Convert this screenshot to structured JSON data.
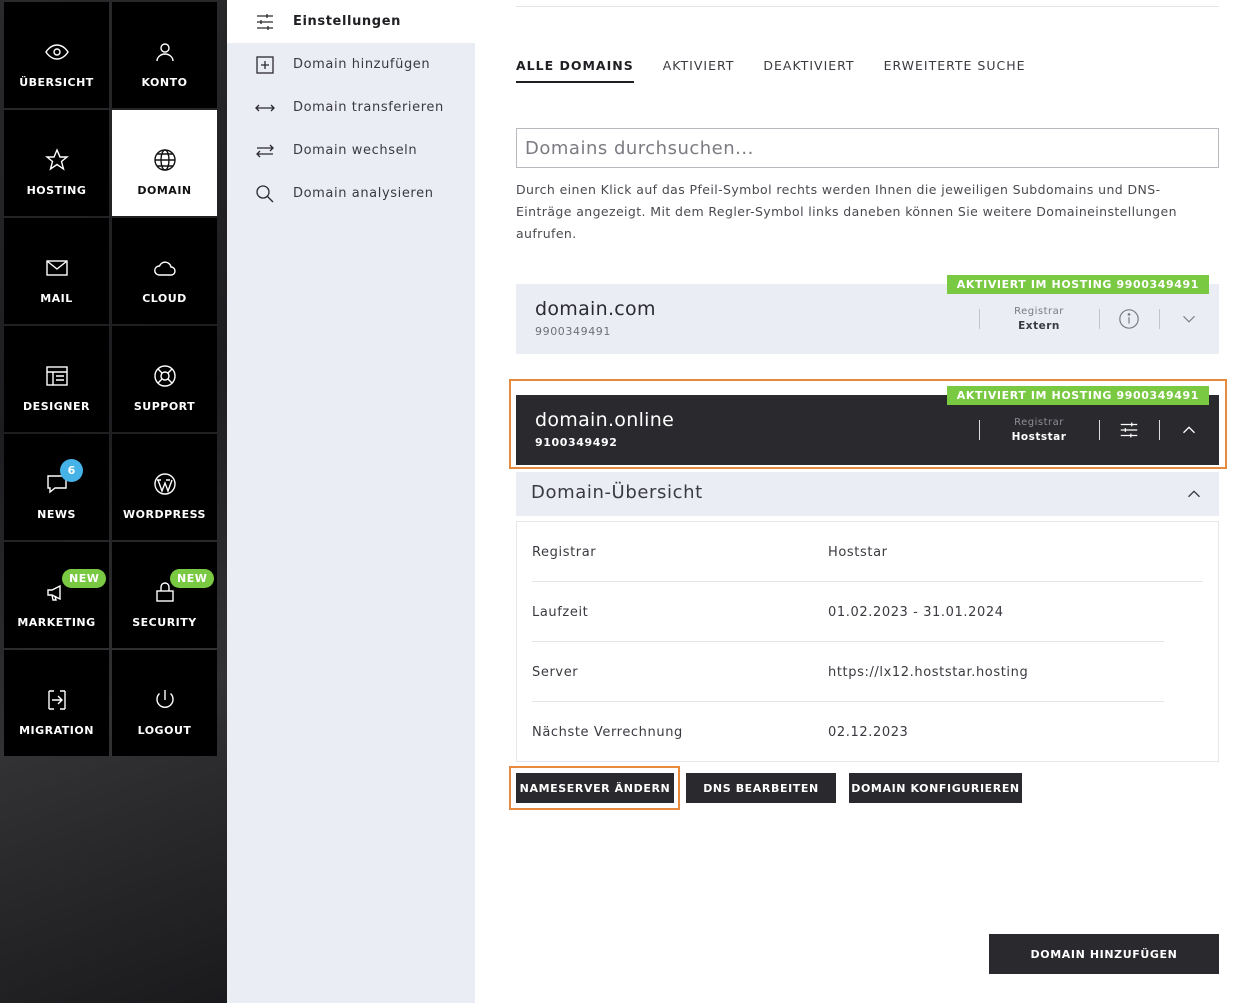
{
  "tiles": [
    {
      "label": "ÜBERSICHT",
      "icon": "eye-icon"
    },
    {
      "label": "KONTO",
      "icon": "user-icon"
    },
    {
      "label": "HOSTING",
      "icon": "star-icon"
    },
    {
      "label": "DOMAIN",
      "icon": "globe-icon"
    },
    {
      "label": "MAIL",
      "icon": "envelope-icon"
    },
    {
      "label": "CLOUD",
      "icon": "cloud-icon"
    },
    {
      "label": "DESIGNER",
      "icon": "layout-icon"
    },
    {
      "label": "SUPPORT",
      "icon": "lifebuoy-icon"
    },
    {
      "label": "NEWS",
      "icon": "chat-bubble-icon",
      "badge": "6"
    },
    {
      "label": "WORDPRESS",
      "icon": "wordpress-icon"
    },
    {
      "label": "MARKETING",
      "icon": "megaphone-icon",
      "badge": "NEW"
    },
    {
      "label": "SECURITY",
      "icon": "lock-icon",
      "badge": "NEW"
    },
    {
      "label": "MIGRATION",
      "icon": "migration-icon"
    },
    {
      "label": "LOGOUT",
      "icon": "power-icon"
    }
  ],
  "submenu": [
    {
      "label": "Einstellungen",
      "icon": "sliders-icon"
    },
    {
      "label": "Domain hinzufügen",
      "icon": "plus-square-icon"
    },
    {
      "label": "Domain transferieren",
      "icon": "arrows-horizontal-icon"
    },
    {
      "label": "Domain wechseln",
      "icon": "swap-icon"
    },
    {
      "label": "Domain analysieren",
      "icon": "search-icon"
    }
  ],
  "tabs": [
    "ALLE DOMAINS",
    "AKTIVIERT",
    "DEAKTIVIERT",
    "ERWEITERTE SUCHE"
  ],
  "search": {
    "placeholder": "Domains durchsuchen..."
  },
  "help_text": "Durch einen Klick auf das Pfeil-Symbol rechts werden Ihnen die jeweiligen Subdomains und DNS-Einträge angezeigt. Mit dem Regler-Symbol links daneben können Sie weitere Domaineinstellungen aufrufen.",
  "domains": [
    {
      "name": "domain.com",
      "id": "9900349491",
      "tag": "AKTIVIERT IM HOSTING 9900349491",
      "registrar_label": "Registrar",
      "registrar": "Extern"
    },
    {
      "name": "domain.online",
      "id": "9100349492",
      "tag": "AKTIVIERT IM HOSTING 9900349491",
      "registrar_label": "Registrar",
      "registrar": "Hoststar"
    }
  ],
  "overview": {
    "title": "Domain-Übersicht",
    "rows": [
      {
        "key": "Registrar",
        "value": "Hoststar"
      },
      {
        "key": "Laufzeit",
        "value": "01.02.2023 - 31.01.2024"
      },
      {
        "key": "Server",
        "value": "https://lx12.hoststar.hosting"
      },
      {
        "key": "Nächste Verrechnung",
        "value": "02.12.2023"
      }
    ]
  },
  "buttons": {
    "nameserver": "NAMESERVER ÄNDERN",
    "dns": "DNS BEARBEITEN",
    "configure": "DOMAIN KONFIGURIEREN",
    "add_domain": "DOMAIN HINZUFÜGEN"
  },
  "colors": {
    "accent_green": "#7ac943",
    "badge_blue": "#45b3e8",
    "highlight_orange": "#e88a3e",
    "dark": "#2a2a2e"
  }
}
